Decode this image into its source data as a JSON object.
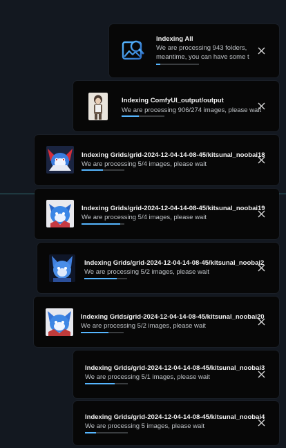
{
  "colors": {
    "background": "#131820",
    "toast_bg": "#070707",
    "accent": "#56b6ff",
    "title": "#f2f2f2",
    "message": "#bfc3c7"
  },
  "toasts": [
    {
      "icon": "image-search-icon",
      "title": "Indexing All",
      "message": "We are processing 943 folders,",
      "message2": "meantime, you can have some tea",
      "progress": 0.1
    },
    {
      "icon": "character-thumbnail",
      "title": "Indexing ComfyUI_output/output",
      "message": "We are processing 906/274 images, please wait",
      "progress": 0.4
    },
    {
      "icon": "character-thumbnail",
      "title": "Indexing Grids/grid-2024-12-04-14-08-45/kitsunal_noobai18",
      "message": "We are processing 5/4 images, please wait",
      "progress": 0.5
    },
    {
      "icon": "character-thumbnail",
      "title": "Indexing Grids/grid-2024-12-04-14-08-45/kitsunal_noobai19",
      "message": "We are processing 5/4 images, please wait",
      "progress": 0.9
    },
    {
      "icon": "character-thumbnail",
      "title": "Indexing Grids/grid-2024-12-04-14-08-45/kitsunal_noobai2",
      "message": "We are processing 5/2 images, please wait",
      "progress": 0.75
    },
    {
      "icon": "character-thumbnail",
      "title": "Indexing Grids/grid-2024-12-04-14-08-45/kitsunal_noobai20",
      "message": "We are processing 5/2 images, please wait",
      "progress": 0.65
    },
    {
      "icon": "character-thumbnail",
      "title": "Indexing Grids/grid-2024-12-04-14-08-45/kitsunal_noobai3",
      "message": "We are processing 5/1 images, please wait",
      "progress": 0.7
    },
    {
      "icon": "character-thumbnail",
      "title": "Indexing Grids/grid-2024-12-04-14-08-45/kitsunal_noobai4",
      "message": "We are processing 5 images, please wait",
      "progress": 0.25
    }
  ]
}
